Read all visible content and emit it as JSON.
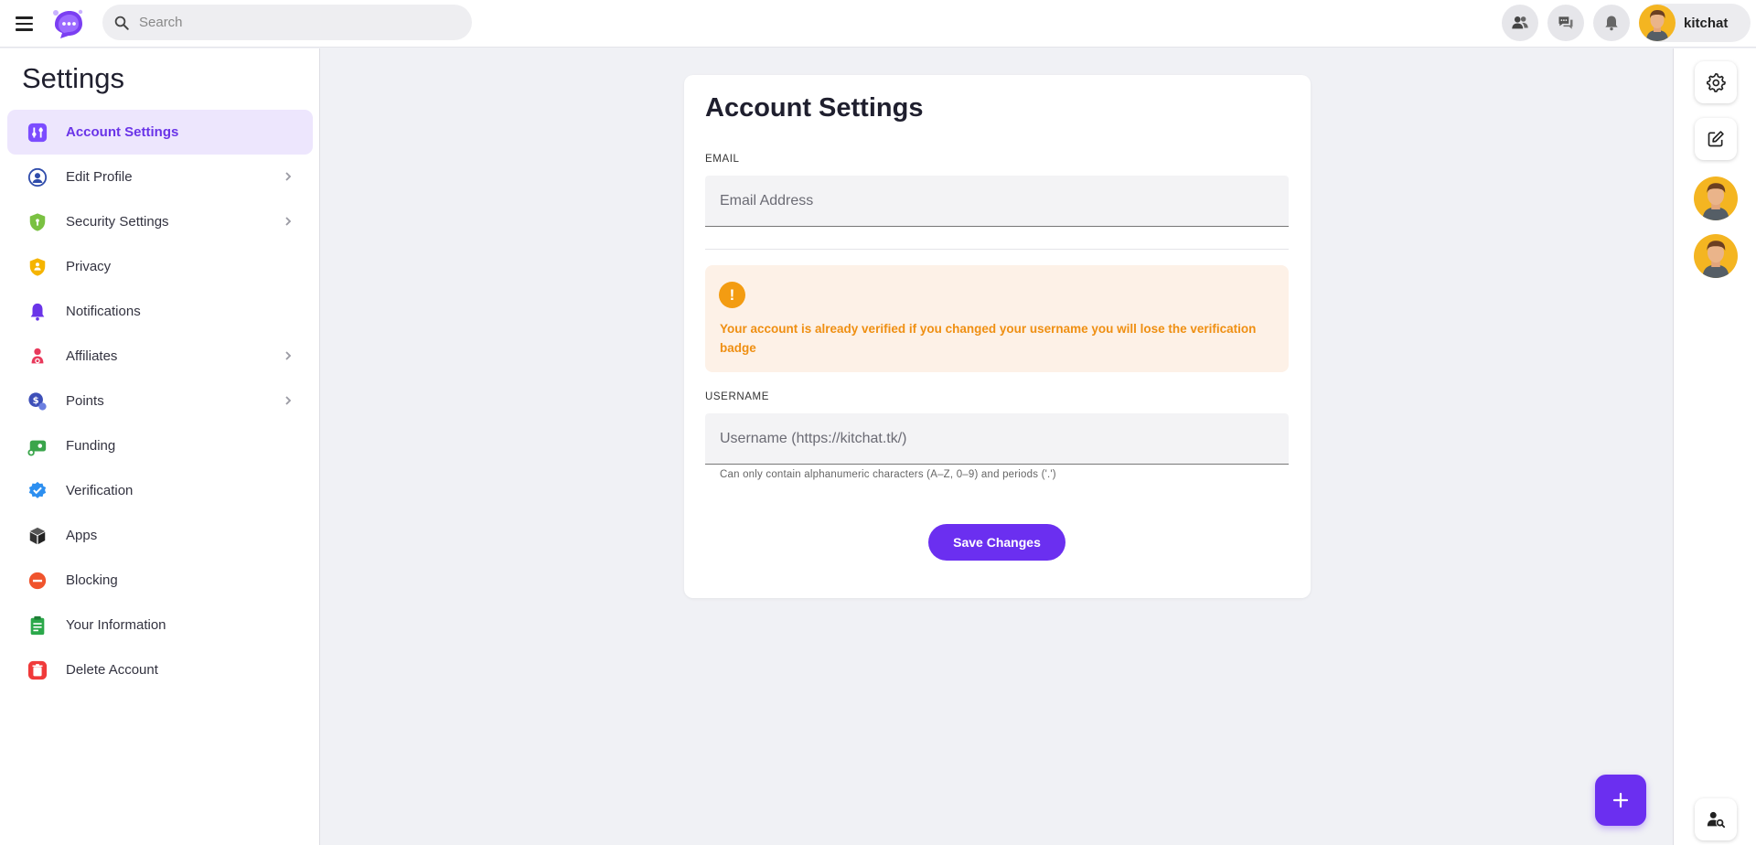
{
  "header": {
    "search_placeholder": "Search",
    "username": "kitchat"
  },
  "sidebar": {
    "title": "Settings",
    "items": [
      {
        "label": "Account Settings",
        "icon": "sliders-icon",
        "color": "#7c4dff",
        "active": true,
        "has_chevron": false
      },
      {
        "label": "Edit Profile",
        "icon": "user-circle-icon",
        "color": "#2f4cab",
        "has_chevron": true
      },
      {
        "label": "Security Settings",
        "icon": "shield-icon",
        "color": "#7ac142",
        "has_chevron": true
      },
      {
        "label": "Privacy",
        "icon": "privacy-icon",
        "color": "#f5b400",
        "has_chevron": false
      },
      {
        "label": "Notifications",
        "icon": "bell-icon",
        "color": "#6a34e8",
        "has_chevron": false
      },
      {
        "label": "Affiliates",
        "icon": "affiliates-icon",
        "color": "#e8395b",
        "has_chevron": true
      },
      {
        "label": "Points",
        "icon": "points-icon",
        "color": "#3d4fb8",
        "has_chevron": true
      },
      {
        "label": "Funding",
        "icon": "funding-icon",
        "color": "#3aa54b",
        "has_chevron": false
      },
      {
        "label": "Verification",
        "icon": "verified-icon",
        "color": "#2d8ff0",
        "has_chevron": false
      },
      {
        "label": "Apps",
        "icon": "cube-icon",
        "color": "#333333",
        "has_chevron": false
      },
      {
        "label": "Blocking",
        "icon": "block-icon",
        "color": "#f0542d",
        "has_chevron": false
      },
      {
        "label": "Your Information",
        "icon": "clipboard-icon",
        "color": "#2ba84a",
        "has_chevron": false
      },
      {
        "label": "Delete Account",
        "icon": "trash-icon",
        "color": "#f03a3a",
        "has_chevron": false
      }
    ]
  },
  "main": {
    "title": "Account Settings",
    "email": {
      "label": "EMAIL",
      "placeholder": "Email Address",
      "value": ""
    },
    "alert": {
      "text": "Your account is already verified if you changed your username you will lose the verification badge",
      "icon": "exclamation-icon",
      "color": "#f39c12"
    },
    "username": {
      "label": "USERNAME",
      "placeholder": "Username (https://kitchat.tk/)",
      "value": "",
      "helper": "Can only contain alphanumeric characters (A–Z, 0–9) and periods ('.')"
    },
    "save_label": "Save Changes"
  },
  "colors": {
    "accent": "#6b2ff0",
    "background": "#f0f1f5"
  }
}
